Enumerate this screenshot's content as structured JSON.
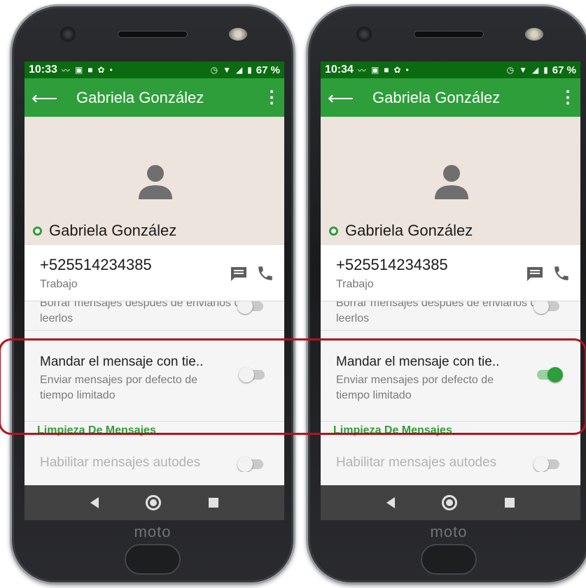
{
  "phones": [
    {
      "status": {
        "time": "10:33",
        "battery": "67 %"
      },
      "app_bar": {
        "title": "Gabriela González"
      },
      "profile": {
        "name": "Gabriela González"
      },
      "contact": {
        "number": "+525514234385",
        "type": "Trabajo"
      },
      "settings": {
        "disappearing": {
          "subtitle": "Borrar mensajes después de enviarlos o leerlos",
          "enabled": false
        },
        "timed_message": {
          "title": "Mandar el mensaje con tie..",
          "subtitle": "Enviar mensajes por defecto de tiempo limitado",
          "enabled": false
        },
        "section_header": "Limpieza De Mensajes",
        "auto_delete": {
          "title": "Habilitar mensajes autodes",
          "enabled": false
        }
      },
      "brand": "moto"
    },
    {
      "status": {
        "time": "10:34",
        "battery": "67 %"
      },
      "app_bar": {
        "title": "Gabriela González"
      },
      "profile": {
        "name": "Gabriela González"
      },
      "contact": {
        "number": "+525514234385",
        "type": "Trabajo"
      },
      "settings": {
        "disappearing": {
          "subtitle": "Borrar mensajes después de enviarlos o leerlos",
          "enabled": false
        },
        "timed_message": {
          "title": "Mandar el mensaje con tie..",
          "subtitle": "Enviar mensajes por defecto de tiempo limitado",
          "enabled": true
        },
        "section_header": "Limpieza De Mensajes",
        "auto_delete": {
          "title": "Habilitar mensajes autodes",
          "enabled": false
        }
      },
      "brand": "moto"
    }
  ],
  "colors": {
    "status_bar": "#0b6b10",
    "app_bar": "#2e9e3a",
    "accent": "#2e9e3a",
    "highlight_box": "#b5121b"
  }
}
